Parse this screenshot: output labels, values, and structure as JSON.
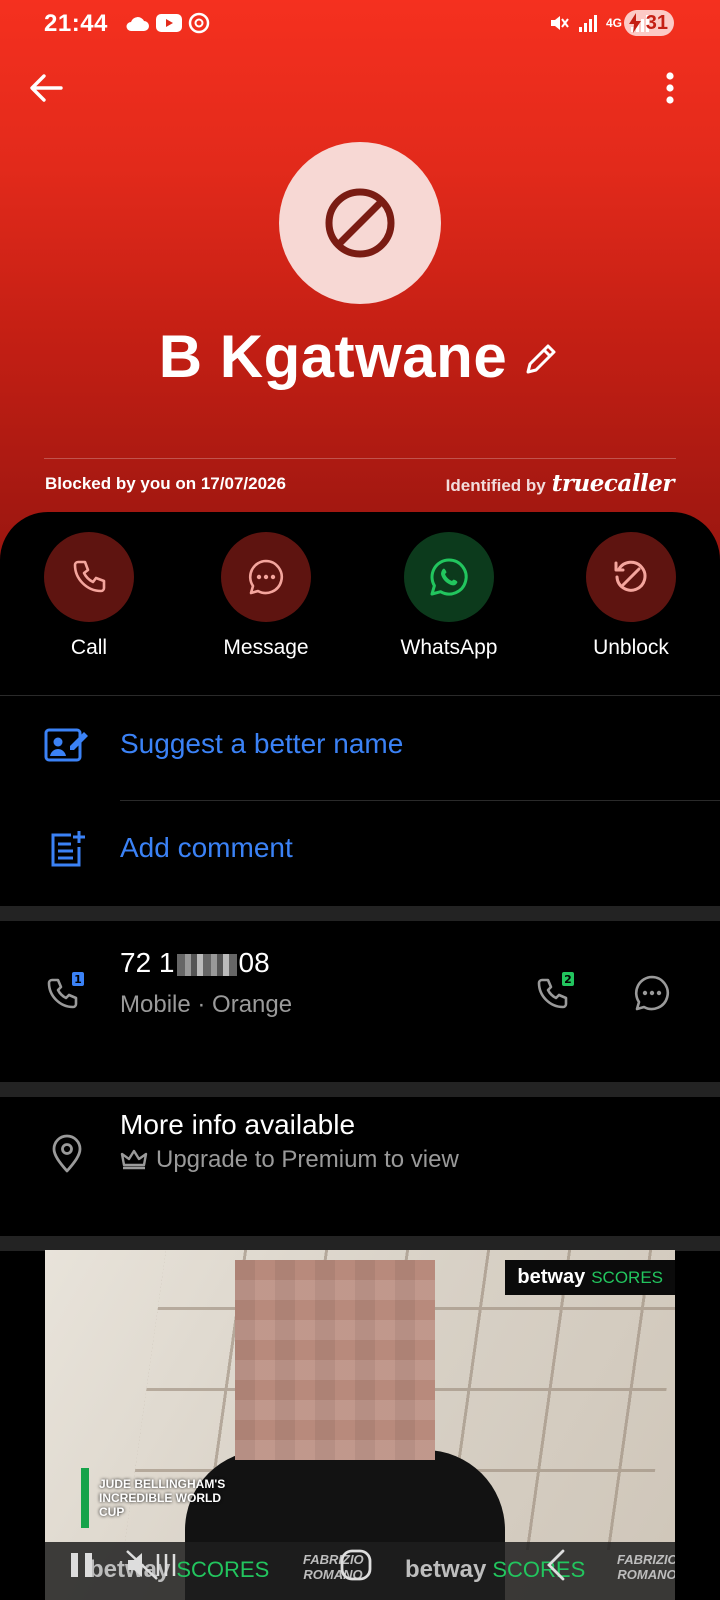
{
  "status_bar": {
    "time": "21:44",
    "network_label": "4G",
    "battery": "31"
  },
  "contact": {
    "name": "B Kgatwane",
    "blocked_text": "Blocked by you on 17/07/2026",
    "identified_label": "Identified by",
    "identified_brand": "truecaller"
  },
  "actions": [
    {
      "label": "Call",
      "icon": "phone-icon"
    },
    {
      "label": "Message",
      "icon": "message-icon"
    },
    {
      "label": "WhatsApp",
      "icon": "whatsapp-icon"
    },
    {
      "label": "Unblock",
      "icon": "unblock-icon"
    }
  ],
  "links": {
    "suggest_name": "Suggest a better name",
    "add_comment": "Add comment"
  },
  "phone": {
    "number_prefix": "72 1",
    "number_suffix": "08",
    "type": "Mobile · Orange",
    "sim1_badge": "1",
    "sim2_badge": "2"
  },
  "more_info": {
    "title": "More info available",
    "subtitle": "Upgrade to Premium to view"
  },
  "ad": {
    "brand": "betway",
    "brand_suffix": "SCORES",
    "lower_third": "JUDE BELLINGHAM'S INCREDIBLE WORLD CUP",
    "strip_text": "FABRIZIO ROMANO"
  },
  "colors": {
    "header_red": "#e22a1b",
    "link_blue": "#3b82f6",
    "whatsapp_green": "#22c55e"
  }
}
